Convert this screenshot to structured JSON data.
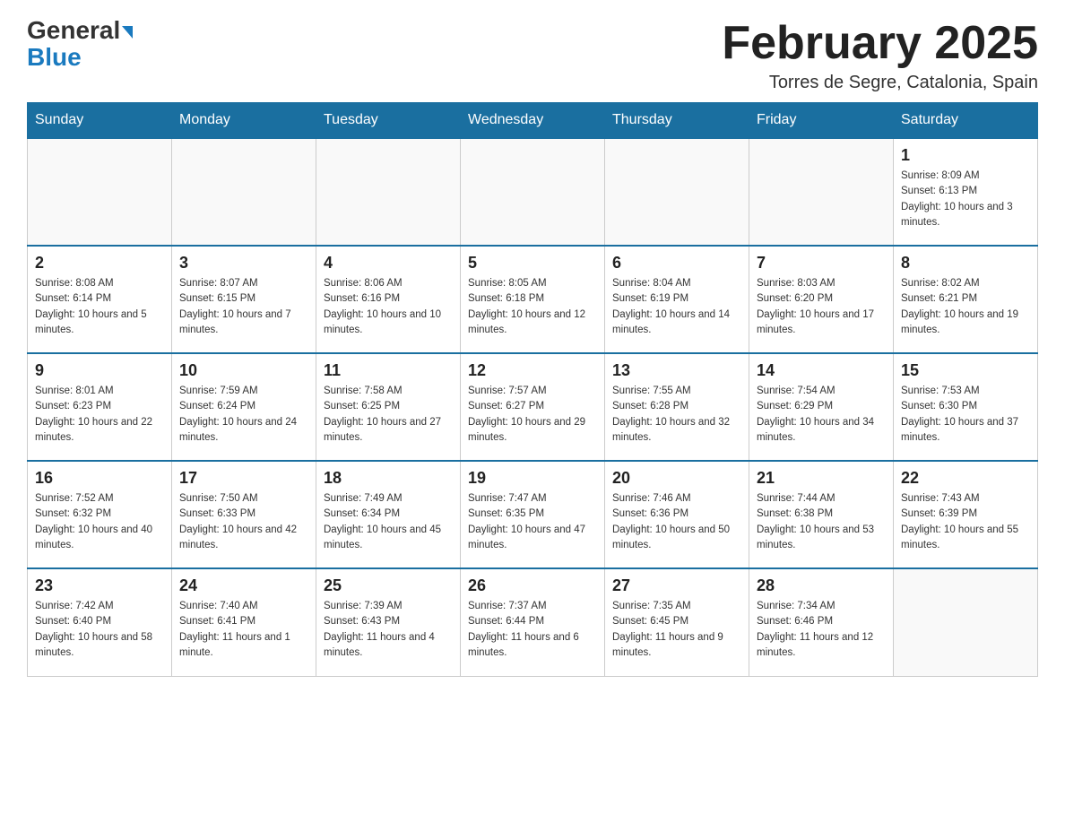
{
  "header": {
    "logo_line1": "General",
    "logo_line2": "Blue",
    "title": "February 2025",
    "subtitle": "Torres de Segre, Catalonia, Spain"
  },
  "days_of_week": [
    "Sunday",
    "Monday",
    "Tuesday",
    "Wednesday",
    "Thursday",
    "Friday",
    "Saturday"
  ],
  "weeks": [
    [
      {
        "day": "",
        "info": ""
      },
      {
        "day": "",
        "info": ""
      },
      {
        "day": "",
        "info": ""
      },
      {
        "day": "",
        "info": ""
      },
      {
        "day": "",
        "info": ""
      },
      {
        "day": "",
        "info": ""
      },
      {
        "day": "1",
        "info": "Sunrise: 8:09 AM\nSunset: 6:13 PM\nDaylight: 10 hours and 3 minutes."
      }
    ],
    [
      {
        "day": "2",
        "info": "Sunrise: 8:08 AM\nSunset: 6:14 PM\nDaylight: 10 hours and 5 minutes."
      },
      {
        "day": "3",
        "info": "Sunrise: 8:07 AM\nSunset: 6:15 PM\nDaylight: 10 hours and 7 minutes."
      },
      {
        "day": "4",
        "info": "Sunrise: 8:06 AM\nSunset: 6:16 PM\nDaylight: 10 hours and 10 minutes."
      },
      {
        "day": "5",
        "info": "Sunrise: 8:05 AM\nSunset: 6:18 PM\nDaylight: 10 hours and 12 minutes."
      },
      {
        "day": "6",
        "info": "Sunrise: 8:04 AM\nSunset: 6:19 PM\nDaylight: 10 hours and 14 minutes."
      },
      {
        "day": "7",
        "info": "Sunrise: 8:03 AM\nSunset: 6:20 PM\nDaylight: 10 hours and 17 minutes."
      },
      {
        "day": "8",
        "info": "Sunrise: 8:02 AM\nSunset: 6:21 PM\nDaylight: 10 hours and 19 minutes."
      }
    ],
    [
      {
        "day": "9",
        "info": "Sunrise: 8:01 AM\nSunset: 6:23 PM\nDaylight: 10 hours and 22 minutes."
      },
      {
        "day": "10",
        "info": "Sunrise: 7:59 AM\nSunset: 6:24 PM\nDaylight: 10 hours and 24 minutes."
      },
      {
        "day": "11",
        "info": "Sunrise: 7:58 AM\nSunset: 6:25 PM\nDaylight: 10 hours and 27 minutes."
      },
      {
        "day": "12",
        "info": "Sunrise: 7:57 AM\nSunset: 6:27 PM\nDaylight: 10 hours and 29 minutes."
      },
      {
        "day": "13",
        "info": "Sunrise: 7:55 AM\nSunset: 6:28 PM\nDaylight: 10 hours and 32 minutes."
      },
      {
        "day": "14",
        "info": "Sunrise: 7:54 AM\nSunset: 6:29 PM\nDaylight: 10 hours and 34 minutes."
      },
      {
        "day": "15",
        "info": "Sunrise: 7:53 AM\nSunset: 6:30 PM\nDaylight: 10 hours and 37 minutes."
      }
    ],
    [
      {
        "day": "16",
        "info": "Sunrise: 7:52 AM\nSunset: 6:32 PM\nDaylight: 10 hours and 40 minutes."
      },
      {
        "day": "17",
        "info": "Sunrise: 7:50 AM\nSunset: 6:33 PM\nDaylight: 10 hours and 42 minutes."
      },
      {
        "day": "18",
        "info": "Sunrise: 7:49 AM\nSunset: 6:34 PM\nDaylight: 10 hours and 45 minutes."
      },
      {
        "day": "19",
        "info": "Sunrise: 7:47 AM\nSunset: 6:35 PM\nDaylight: 10 hours and 47 minutes."
      },
      {
        "day": "20",
        "info": "Sunrise: 7:46 AM\nSunset: 6:36 PM\nDaylight: 10 hours and 50 minutes."
      },
      {
        "day": "21",
        "info": "Sunrise: 7:44 AM\nSunset: 6:38 PM\nDaylight: 10 hours and 53 minutes."
      },
      {
        "day": "22",
        "info": "Sunrise: 7:43 AM\nSunset: 6:39 PM\nDaylight: 10 hours and 55 minutes."
      }
    ],
    [
      {
        "day": "23",
        "info": "Sunrise: 7:42 AM\nSunset: 6:40 PM\nDaylight: 10 hours and 58 minutes."
      },
      {
        "day": "24",
        "info": "Sunrise: 7:40 AM\nSunset: 6:41 PM\nDaylight: 11 hours and 1 minute."
      },
      {
        "day": "25",
        "info": "Sunrise: 7:39 AM\nSunset: 6:43 PM\nDaylight: 11 hours and 4 minutes."
      },
      {
        "day": "26",
        "info": "Sunrise: 7:37 AM\nSunset: 6:44 PM\nDaylight: 11 hours and 6 minutes."
      },
      {
        "day": "27",
        "info": "Sunrise: 7:35 AM\nSunset: 6:45 PM\nDaylight: 11 hours and 9 minutes."
      },
      {
        "day": "28",
        "info": "Sunrise: 7:34 AM\nSunset: 6:46 PM\nDaylight: 11 hours and 12 minutes."
      },
      {
        "day": "",
        "info": ""
      }
    ]
  ]
}
